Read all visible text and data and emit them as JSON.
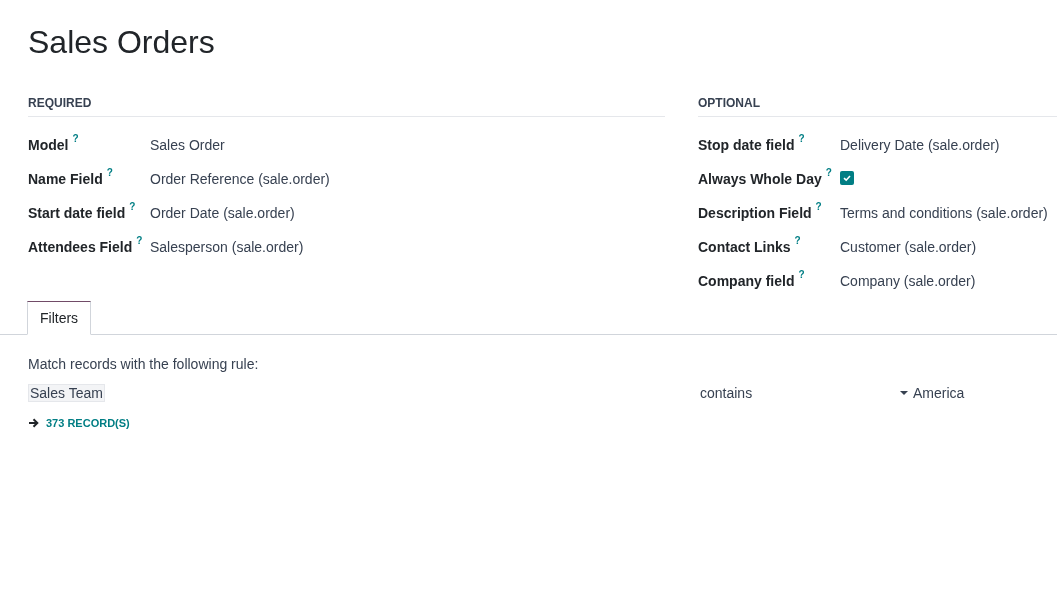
{
  "title": "Sales Orders",
  "sections": [
    {
      "heading": "REQUIRED",
      "fields": [
        {
          "label": "Model",
          "help_mark": "?",
          "kind": "text",
          "value": "Sales Order"
        },
        {
          "label": "Name Field",
          "help_mark": "?",
          "kind": "text",
          "value": "Order Reference (sale.order)"
        },
        {
          "label": "Start date field",
          "help_mark": "?",
          "kind": "text",
          "value": "Order Date (sale.order)"
        },
        {
          "label": "Attendees Field",
          "help_mark": "?",
          "kind": "text",
          "value": "Salesperson (sale.order)"
        }
      ]
    },
    {
      "heading": "OPTIONAL",
      "fields": [
        {
          "label": "Stop date field",
          "help_mark": "?",
          "kind": "text",
          "value": "Delivery Date (sale.order)"
        },
        {
          "label": "Always Whole Day",
          "help_mark": "?",
          "kind": "checkbox",
          "checked": true
        },
        {
          "label": "Description Field",
          "help_mark": "?",
          "kind": "text",
          "value": "Terms and conditions (sale.order)"
        },
        {
          "label": "Contact Links",
          "help_mark": "?",
          "kind": "text",
          "value": "Customer (sale.order)"
        },
        {
          "label": "Company field",
          "help_mark": "?",
          "kind": "text",
          "value": "Company (sale.order)"
        }
      ]
    }
  ],
  "tabs": [
    {
      "label": "Filters",
      "selected": true
    }
  ],
  "filter": {
    "intro": "Match records with the following rule:",
    "field": "Sales Team",
    "operator": "contains",
    "value": "America",
    "records_link": "373 RECORD(S)"
  }
}
